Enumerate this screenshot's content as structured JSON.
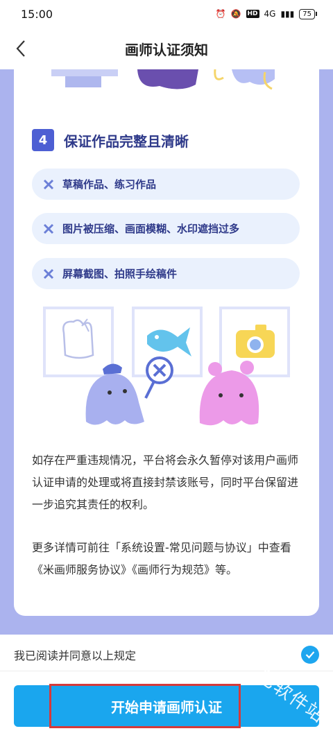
{
  "status": {
    "time": "15:00",
    "network": "4G",
    "hd": "HD",
    "battery": "75"
  },
  "nav": {
    "title": "画师认证须知"
  },
  "section": {
    "number": "4",
    "title": "保证作品完整且清晰"
  },
  "rules": [
    {
      "text": "草稿作品、练习作品"
    },
    {
      "text": "图片被压缩、画面模糊、水印遮挡过多"
    },
    {
      "text": "屏幕截图、拍照手绘稿件"
    }
  ],
  "paragraphs": [
    "如存在严重违规情况，平台将会永久暂停对该用户画师认证申请的处理或将直接封禁该账号，同时平台保留进一步追究其责任的权利。",
    "更多详情可前往「系统设置-常见问题与协议」中查看《米画师服务协议》《画师行为规范》等。"
  ],
  "agree": {
    "label": "我已阅读并同意以上规定",
    "checked": true
  },
  "apply_button": {
    "label": "开始申请画师认证"
  },
  "watermark": "巴软件站",
  "colors": {
    "accent": "#1aa6ee",
    "badge": "#4d5fd3",
    "background": "#abb3ee",
    "pill": "#eaf1fd",
    "highlight": "#d63a3a"
  }
}
